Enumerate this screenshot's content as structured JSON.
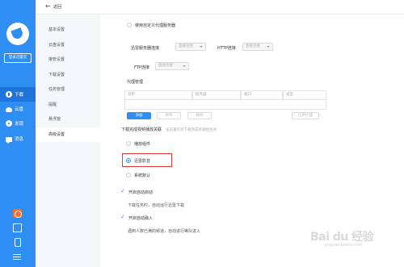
{
  "sidebar": {
    "login_label": "登录迅雷云",
    "nav": [
      {
        "label": "下载",
        "icon": "download-icon"
      },
      {
        "label": "云盘",
        "icon": "cloud-icon"
      },
      {
        "label": "发现",
        "icon": "discover-icon"
      },
      {
        "label": "消息",
        "icon": "message-icon"
      }
    ],
    "bottom_icons": [
      "gift-icon",
      "skin-icon",
      "phone-icon",
      "menu-icon"
    ]
  },
  "topbar": {
    "back_label": "返回"
  },
  "categories": [
    "基本设置",
    "云盘设置",
    "接管设置",
    "下载设置",
    "任务管理",
    "提醒",
    "悬浮窗",
    "高级设置"
  ],
  "active_category": "高级设置",
  "proxy": {
    "use_custom_label": "使用自定义代理服务器",
    "pool_label": "迅雷服务器连接",
    "pool_value": "直接连接",
    "http_label": "HTTP连接",
    "http_value": "直接连接",
    "ftp_label": "FTP连接",
    "ftp_value": "直接连接",
    "manage_title": "代理管理",
    "columns": [
      "名称",
      "服务器",
      "端口",
      "类型"
    ],
    "add_label": "添加",
    "edit_label": "修改",
    "delete_label": "删除",
    "apply_label": "应用代理"
  },
  "after_download": {
    "title": "下载完成视频播放关联",
    "hint": "该设置仅对下载完成的视频生效",
    "options": [
      "播放组件",
      "迅雷影音",
      "系统默认"
    ],
    "selected": "迅雷影音"
  },
  "auto_start": {
    "label": "开启自动启动",
    "desc": "下载任务时，自动运行迅雷下载"
  },
  "auto_join": {
    "label": "开启自动融入",
    "desc": "遇到人数已满的频道，自动进行等队进入"
  },
  "watermark": {
    "main": "Bai du 经验",
    "sub": "jingyan.baidu.com"
  }
}
